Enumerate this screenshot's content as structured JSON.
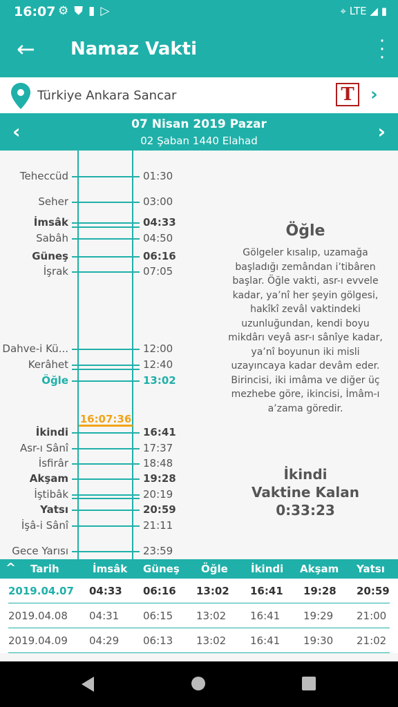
{
  "status": {
    "time": "16:07",
    "network": "LTE"
  },
  "appbar": {
    "title": "Namaz Vakti"
  },
  "location": {
    "text": "Türkiye Ankara Sancar",
    "logo_letter": "T"
  },
  "date": {
    "gregorian": "07 Nisan 2019 Pazar",
    "hijri": "02 Şaban 1440 Elahad"
  },
  "timeline": [
    {
      "name": "Teheccüd",
      "time": "01:30",
      "style": ""
    },
    {
      "name": "Seher",
      "time": "03:00",
      "style": ""
    },
    {
      "name": "İmsâk",
      "time": "04:33",
      "style": "bold"
    },
    {
      "name": "Sabâh",
      "time": "04:50",
      "style": ""
    },
    {
      "name": "Güneş",
      "time": "06:16",
      "style": "bold"
    },
    {
      "name": "İşrak",
      "time": "07:05",
      "style": ""
    },
    {
      "name": "Dahve-i Kü...",
      "time": "12:00",
      "style": ""
    },
    {
      "name": "Kerâhet",
      "time": "12:40",
      "style": ""
    },
    {
      "name": "Öğle",
      "time": "13:02",
      "style": "active"
    },
    {
      "name": "İkindi",
      "time": "16:41",
      "style": "bold"
    },
    {
      "name": "Asr-ı Sânî",
      "time": "17:37",
      "style": ""
    },
    {
      "name": "İsfirâr",
      "time": "18:48",
      "style": ""
    },
    {
      "name": "Akşam",
      "time": "19:28",
      "style": "bold"
    },
    {
      "name": "İştibâk",
      "time": "20:19",
      "style": ""
    },
    {
      "name": "Yatsı",
      "time": "20:59",
      "style": "bold"
    },
    {
      "name": "İşâ-i Sânî",
      "time": "21:11",
      "style": ""
    },
    {
      "name": "Gece Yarısı",
      "time": "23:59",
      "style": ""
    }
  ],
  "now": "16:07:36",
  "info": {
    "title": "Öğle",
    "description": "Gölgeler kısalıp, uzamağa başladığı zemândan i’tibâren başlar. Öğle vakti, asr-ı evvele kadar, ya’nî her şeyin gölgesi, hakîkî zevâl vaktindeki uzunluğundan, kendi boyu mikdârı veyâ asr-ı sânîye kadar, ya’nî boyunun iki misli uzayıncaya kadar devâm eder. Birincisi, iki imâma ve diğer üç mezhebe göre, ikincisi, İmâm-ı a’zama göredir.",
    "remaining_line1": "İkindi",
    "remaining_line2": "Vaktine Kalan",
    "remaining_time": "0:33:23"
  },
  "table": {
    "headers": [
      "Tarih",
      "İmsâk",
      "Güneş",
      "Öğle",
      "İkindi",
      "Akşam",
      "Yatsı"
    ],
    "rows": [
      [
        "2019.04.07",
        "04:33",
        "06:16",
        "13:02",
        "16:41",
        "19:28",
        "20:59"
      ],
      [
        "2019.04.08",
        "04:31",
        "06:15",
        "13:02",
        "16:41",
        "19:29",
        "21:00"
      ],
      [
        "2019.04.09",
        "04:29",
        "06:13",
        "13:02",
        "16:41",
        "19:30",
        "21:02"
      ]
    ]
  },
  "colors": {
    "accent": "#1fb0a9",
    "now": "#f2a316"
  }
}
